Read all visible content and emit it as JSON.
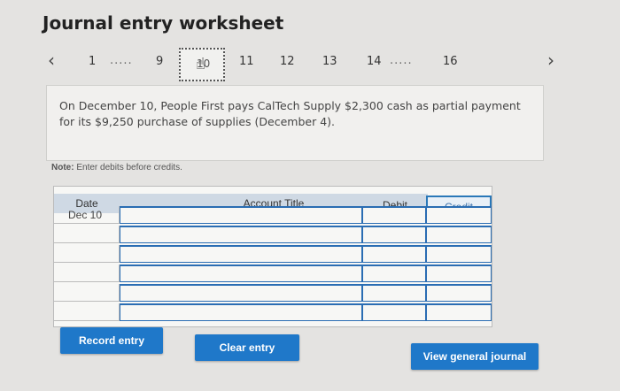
{
  "title": "Journal entry worksheet",
  "pager": {
    "pages_left": [
      "1",
      "9"
    ],
    "current": "10",
    "pages_right": [
      "11",
      "12",
      "13",
      "14",
      "16"
    ],
    "ellipsis": "....."
  },
  "question": "On December 10, People First pays CalTech Supply $2,300 cash as partial payment for its $9,250 purchase of supplies (December 4).",
  "note": {
    "label": "Note:",
    "text": "Enter debits before credits."
  },
  "table": {
    "headers": {
      "date": "Date",
      "account": "Account Title",
      "debit": "Debit",
      "credit": "Credit"
    },
    "rows": [
      {
        "date": "Dec 10"
      },
      {
        "date": ""
      },
      {
        "date": ""
      },
      {
        "date": ""
      },
      {
        "date": ""
      },
      {
        "date": ""
      }
    ]
  },
  "buttons": {
    "record": "Record entry",
    "clear": "Clear entry",
    "view": "View general journal"
  },
  "colors": {
    "accent": "#1f78c9",
    "background": "#e4e3e1"
  }
}
